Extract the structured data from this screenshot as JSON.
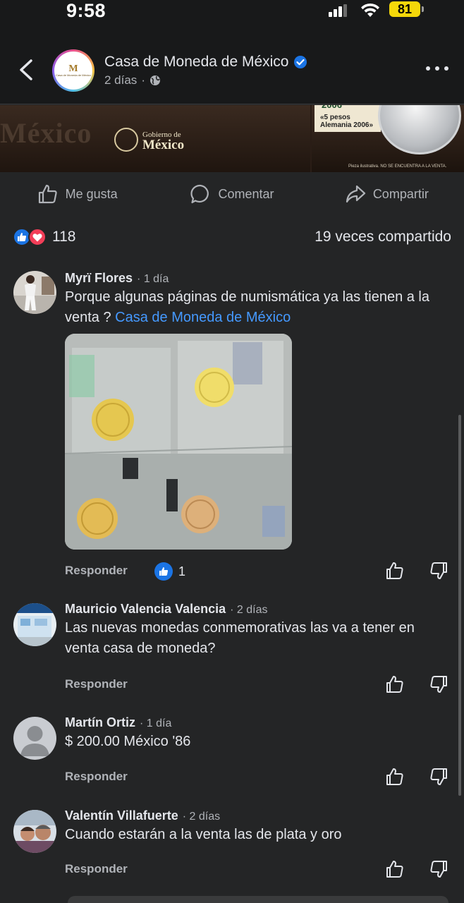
{
  "status_bar": {
    "time": "9:58",
    "battery": "81"
  },
  "header": {
    "page_name": "Casa de Moneda de México",
    "meta": "2 días",
    "logo_mark": "M",
    "logo_text": "Casa de Moneda de México"
  },
  "post_image": {
    "bg_word": "México",
    "gov_line1": "Gobierno de",
    "gov_line2": "México",
    "coin_year": "2006",
    "coin_card_line1": "«5 pesos",
    "coin_card_line2": "Alemania 2006»",
    "note": "Pieza ilustrativa. NO SE ENCUENTRA A LA VENTA."
  },
  "actions": {
    "like": "Me gusta",
    "comment": "Comentar",
    "share": "Compartir"
  },
  "reactions": {
    "count": "118",
    "shares": "19 veces compartido"
  },
  "comments": [
    {
      "name": "Myrï Flores",
      "time": "1 día",
      "text": "Porque algunas páginas de numismática ya las tienen a la venta ?",
      "mention": "Casa de Moneda de México",
      "reply": "Responder",
      "reaction_count": "1"
    },
    {
      "name": "Mauricio Valencia Valencia",
      "time": "2 días",
      "text": "Las nuevas monedas conmemorativas las va a tener en venta casa de moneda?",
      "reply": "Responder"
    },
    {
      "name": "Martín Ortiz",
      "time": "1 día",
      "text": "$ 200.00 México '86",
      "reply": "Responder"
    },
    {
      "name": "Valentín Villafuerte",
      "time": "2 días",
      "text": "Cuando estarán a la venta las de plata y oro",
      "reply": "Responder"
    }
  ],
  "colors": {
    "background": "#242526",
    "link": "#4599ff",
    "like_blue": "#1b74e4",
    "love_red": "#f33e58",
    "battery": "#f5d80a"
  }
}
